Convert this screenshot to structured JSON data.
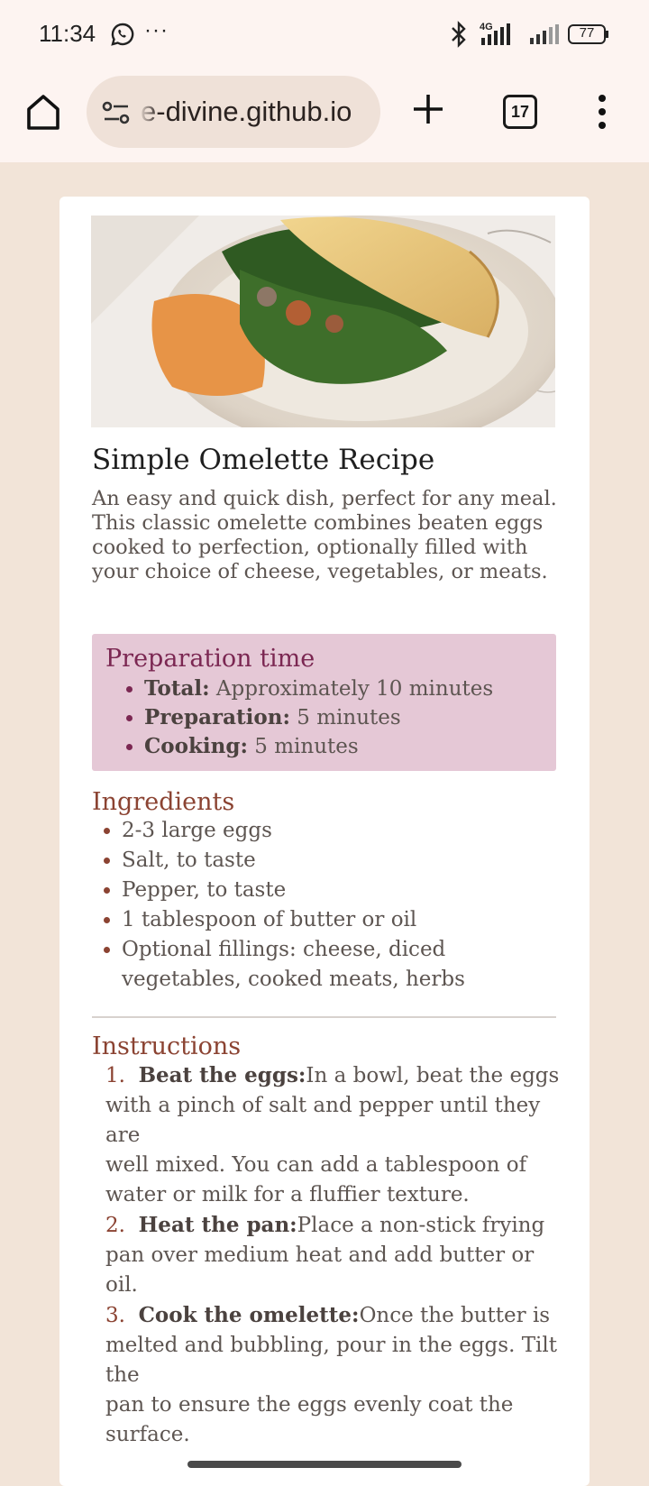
{
  "status_bar": {
    "time": "11:34",
    "more": "···",
    "network_type": "4G",
    "battery": "77"
  },
  "browser": {
    "url_display": "e-divine.github.io",
    "tab_count": "17"
  },
  "recipe": {
    "title": "Simple Omelette Recipe",
    "description_1": "An easy and quick dish, perfect for any meal. This classic omelette combines beaten eggs",
    "description_2": "cooked to perfection, optionally filled with your choice of cheese, vegetables, or meats.",
    "preparation": {
      "heading": "Preparation time",
      "items": [
        {
          "label": "Total:",
          "value": "Approximately 10 minutes"
        },
        {
          "label": "Preparation:",
          "value": "5 minutes"
        },
        {
          "label": "Cooking:",
          "value": "5 minutes"
        }
      ]
    },
    "ingredients": {
      "heading": "Ingredients",
      "items": [
        "2-3 large eggs",
        "Salt, to taste",
        "Pepper, to taste",
        "1 tablespoon of butter or oil",
        "Optional fillings: cheese, diced vegetables, cooked meats, herbs"
      ]
    },
    "instructions": {
      "heading": "Instructions",
      "steps": [
        {
          "num": "1.",
          "label": "Beat the eggs:",
          "text_1": "In a bowl, beat the eggs with a pinch of salt and pepper until they are",
          "text_2": "well mixed. You can add a tablespoon of water or milk for a fluffier texture."
        },
        {
          "num": "2.",
          "label": "Heat the pan:",
          "text_1": "Place a non-stick frying pan over medium heat and add butter or oil.",
          "text_2": ""
        },
        {
          "num": "3.",
          "label": "Cook the omelette:",
          "text_1": "Once the butter is melted and bubbling, pour in the eggs. Tilt the",
          "text_2": "pan to ensure the eggs evenly coat the surface."
        }
      ]
    }
  },
  "colors": {
    "page_background": "#f2e4d8",
    "prep_box": "#e5c8d6",
    "prep_heading": "#7b2752",
    "section_heading": "#8b4332"
  }
}
